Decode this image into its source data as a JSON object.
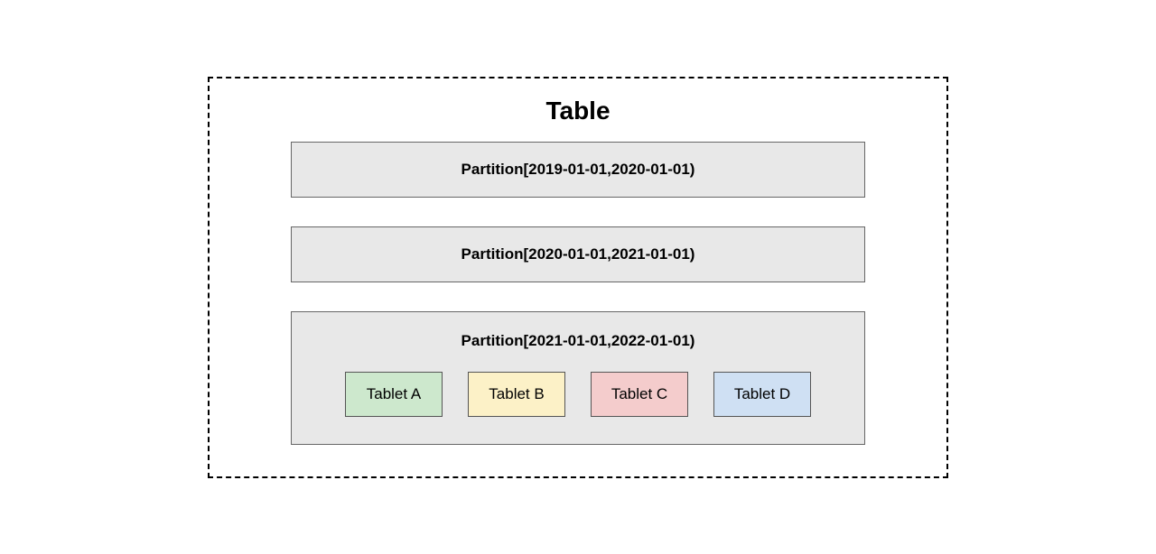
{
  "table": {
    "title": "Table",
    "partitions": [
      {
        "label": "Partition[2019-01-01,2020-01-01)"
      },
      {
        "label": "Partition[2020-01-01,2021-01-01)"
      },
      {
        "label": "Partition[2021-01-01,2022-01-01)",
        "tablets": [
          {
            "label": "Tablet A",
            "color": "green"
          },
          {
            "label": "Tablet B",
            "color": "yellow"
          },
          {
            "label": "Tablet C",
            "color": "red"
          },
          {
            "label": "Tablet D",
            "color": "blue"
          }
        ]
      }
    ]
  }
}
